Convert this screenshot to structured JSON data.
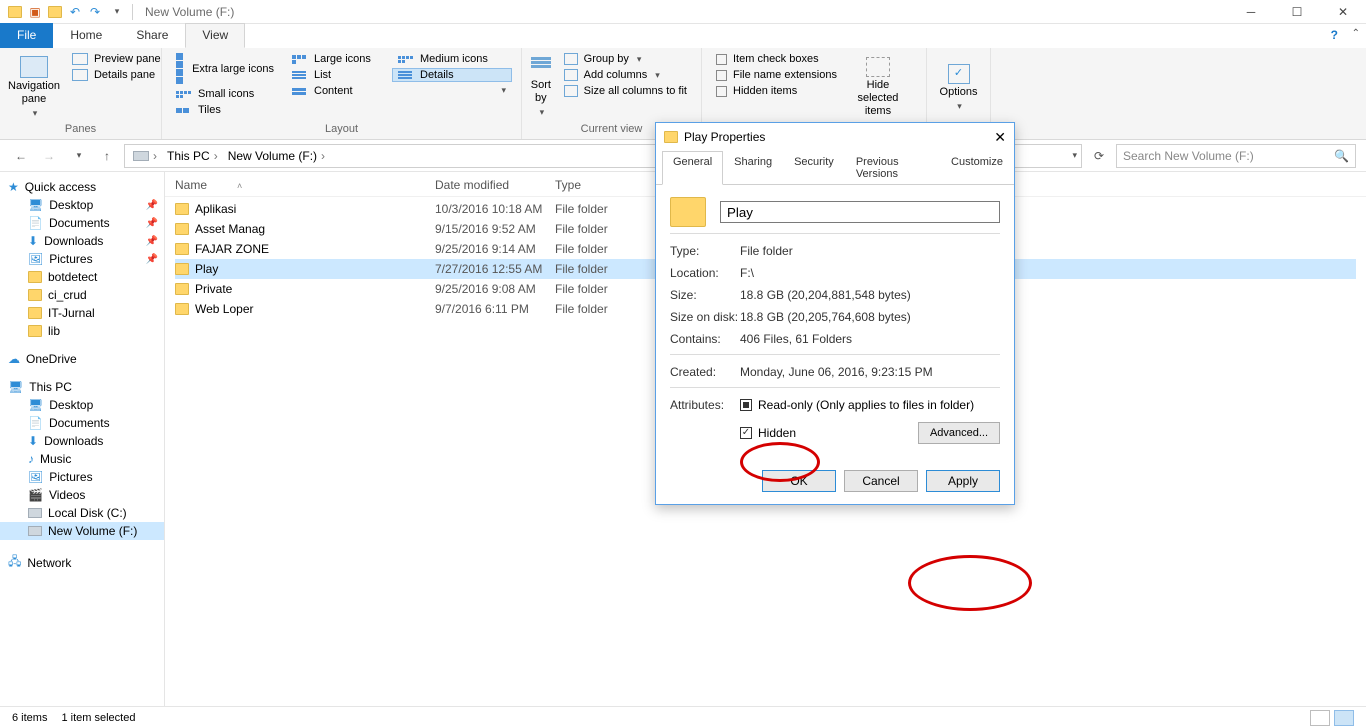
{
  "window": {
    "title": "New Volume (F:)"
  },
  "tabs": {
    "file": "File",
    "home": "Home",
    "share": "Share",
    "view": "View"
  },
  "ribbon": {
    "panes": {
      "label": "Panes",
      "nav": "Navigation pane",
      "preview": "Preview pane",
      "details": "Details pane"
    },
    "layout": {
      "label": "Layout",
      "xl": "Extra large icons",
      "lg": "Large icons",
      "md": "Medium icons",
      "sm": "Small icons",
      "list": "List",
      "details": "Details",
      "tiles": "Tiles",
      "content": "Content"
    },
    "view": {
      "label": "Current view",
      "sort": "Sort by",
      "group": "Group by",
      "addcols": "Add columns",
      "fit": "Size all columns to fit"
    },
    "showhide": {
      "cb": "Item check boxes",
      "ext": "File name extensions",
      "hid": "Hidden items",
      "hidesel": "Hide selected items"
    },
    "options": "Options"
  },
  "breadcrumb": {
    "thispc": "This PC",
    "drive": "New Volume (F:)"
  },
  "search": {
    "placeholder": "Search New Volume (F:)"
  },
  "sidebar": {
    "quick": "Quick access",
    "desktop": "Desktop",
    "documents": "Documents",
    "downloads": "Downloads",
    "pictures": "Pictures",
    "botdetect": "botdetect",
    "cicrud": "ci_crud",
    "itjurnal": "IT-Jurnal",
    "lib": "lib",
    "onedrive": "OneDrive",
    "thispc": "This PC",
    "t_desktop": "Desktop",
    "t_documents": "Documents",
    "t_downloads": "Downloads",
    "t_music": "Music",
    "t_pictures": "Pictures",
    "t_videos": "Videos",
    "localc": "Local Disk (C:)",
    "newf": "New Volume (F:)",
    "network": "Network"
  },
  "cols": {
    "name": "Name",
    "date": "Date modified",
    "type": "Type"
  },
  "rows": [
    {
      "name": "Aplikasi",
      "date": "10/3/2016 10:18 AM",
      "type": "File folder"
    },
    {
      "name": "Asset Manag",
      "date": "9/15/2016 9:52 AM",
      "type": "File folder"
    },
    {
      "name": "FAJAR ZONE",
      "date": "9/25/2016 9:14 AM",
      "type": "File folder"
    },
    {
      "name": "Play",
      "date": "7/27/2016 12:55 AM",
      "type": "File folder"
    },
    {
      "name": "Private",
      "date": "9/25/2016 9:08 AM",
      "type": "File folder"
    },
    {
      "name": "Web Loper",
      "date": "9/7/2016 6:11 PM",
      "type": "File folder"
    }
  ],
  "status": {
    "items": "6 items",
    "sel": "1 item selected"
  },
  "dialog": {
    "title": "Play Properties",
    "tabs": {
      "general": "General",
      "sharing": "Sharing",
      "security": "Security",
      "prev": "Previous Versions",
      "cust": "Customize"
    },
    "name": "Play",
    "type_k": "Type:",
    "type_v": "File folder",
    "loc_k": "Location:",
    "loc_v": "F:\\",
    "size_k": "Size:",
    "size_v": "18.8 GB (20,204,881,548 bytes)",
    "sod_k": "Size on disk:",
    "sod_v": "18.8 GB (20,205,764,608 bytes)",
    "cont_k": "Contains:",
    "cont_v": "406 Files, 61 Folders",
    "created_k": "Created:",
    "created_v": "Monday, June 06, 2016, 9:23:15 PM",
    "attr_k": "Attributes:",
    "readonly": "Read-only (Only applies to files in folder)",
    "hidden": "Hidden",
    "advanced": "Advanced...",
    "ok": "OK",
    "cancel": "Cancel",
    "apply": "Apply"
  }
}
